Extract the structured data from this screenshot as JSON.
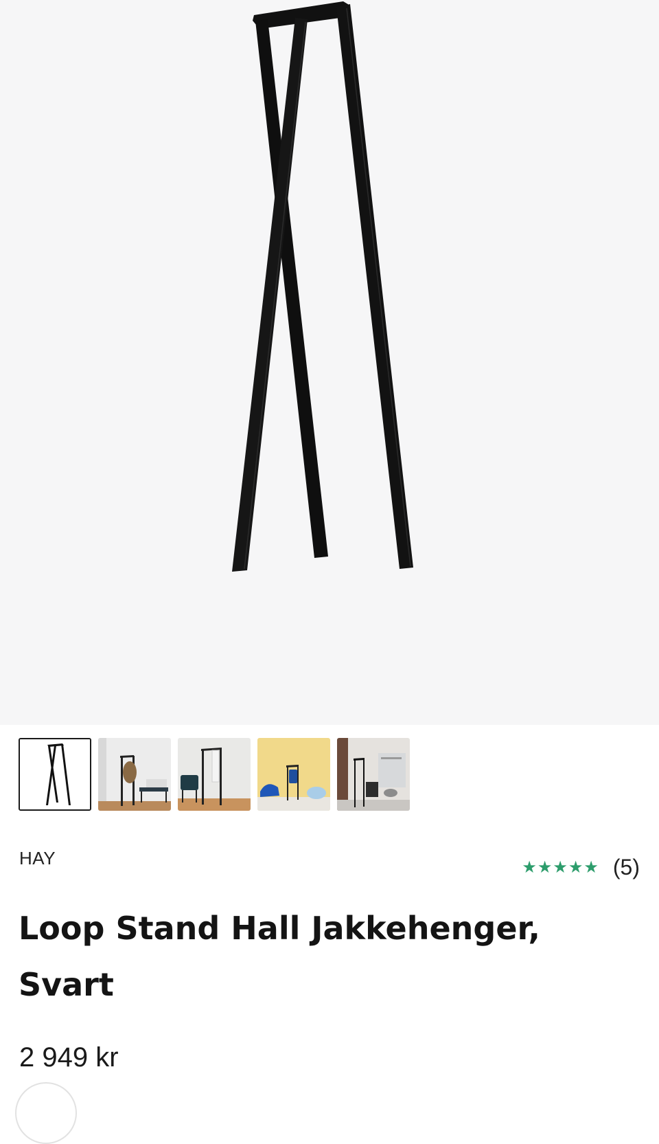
{
  "product": {
    "brand": "HAY",
    "title": "Loop Stand Hall Jakkehenger, Svart",
    "price": "2 949 kr",
    "rating": {
      "stars": "★★★★★",
      "value": 5,
      "count_label": "(5)",
      "color": "#2d9d6c"
    }
  },
  "gallery": {
    "thumbnails": [
      {
        "name": "thumb-product-black",
        "selected": true
      },
      {
        "name": "thumb-hallway-bench",
        "selected": false
      },
      {
        "name": "thumb-hallway-chair",
        "selected": false
      },
      {
        "name": "thumb-yellow-room",
        "selected": false
      },
      {
        "name": "thumb-showroom",
        "selected": false
      }
    ]
  }
}
